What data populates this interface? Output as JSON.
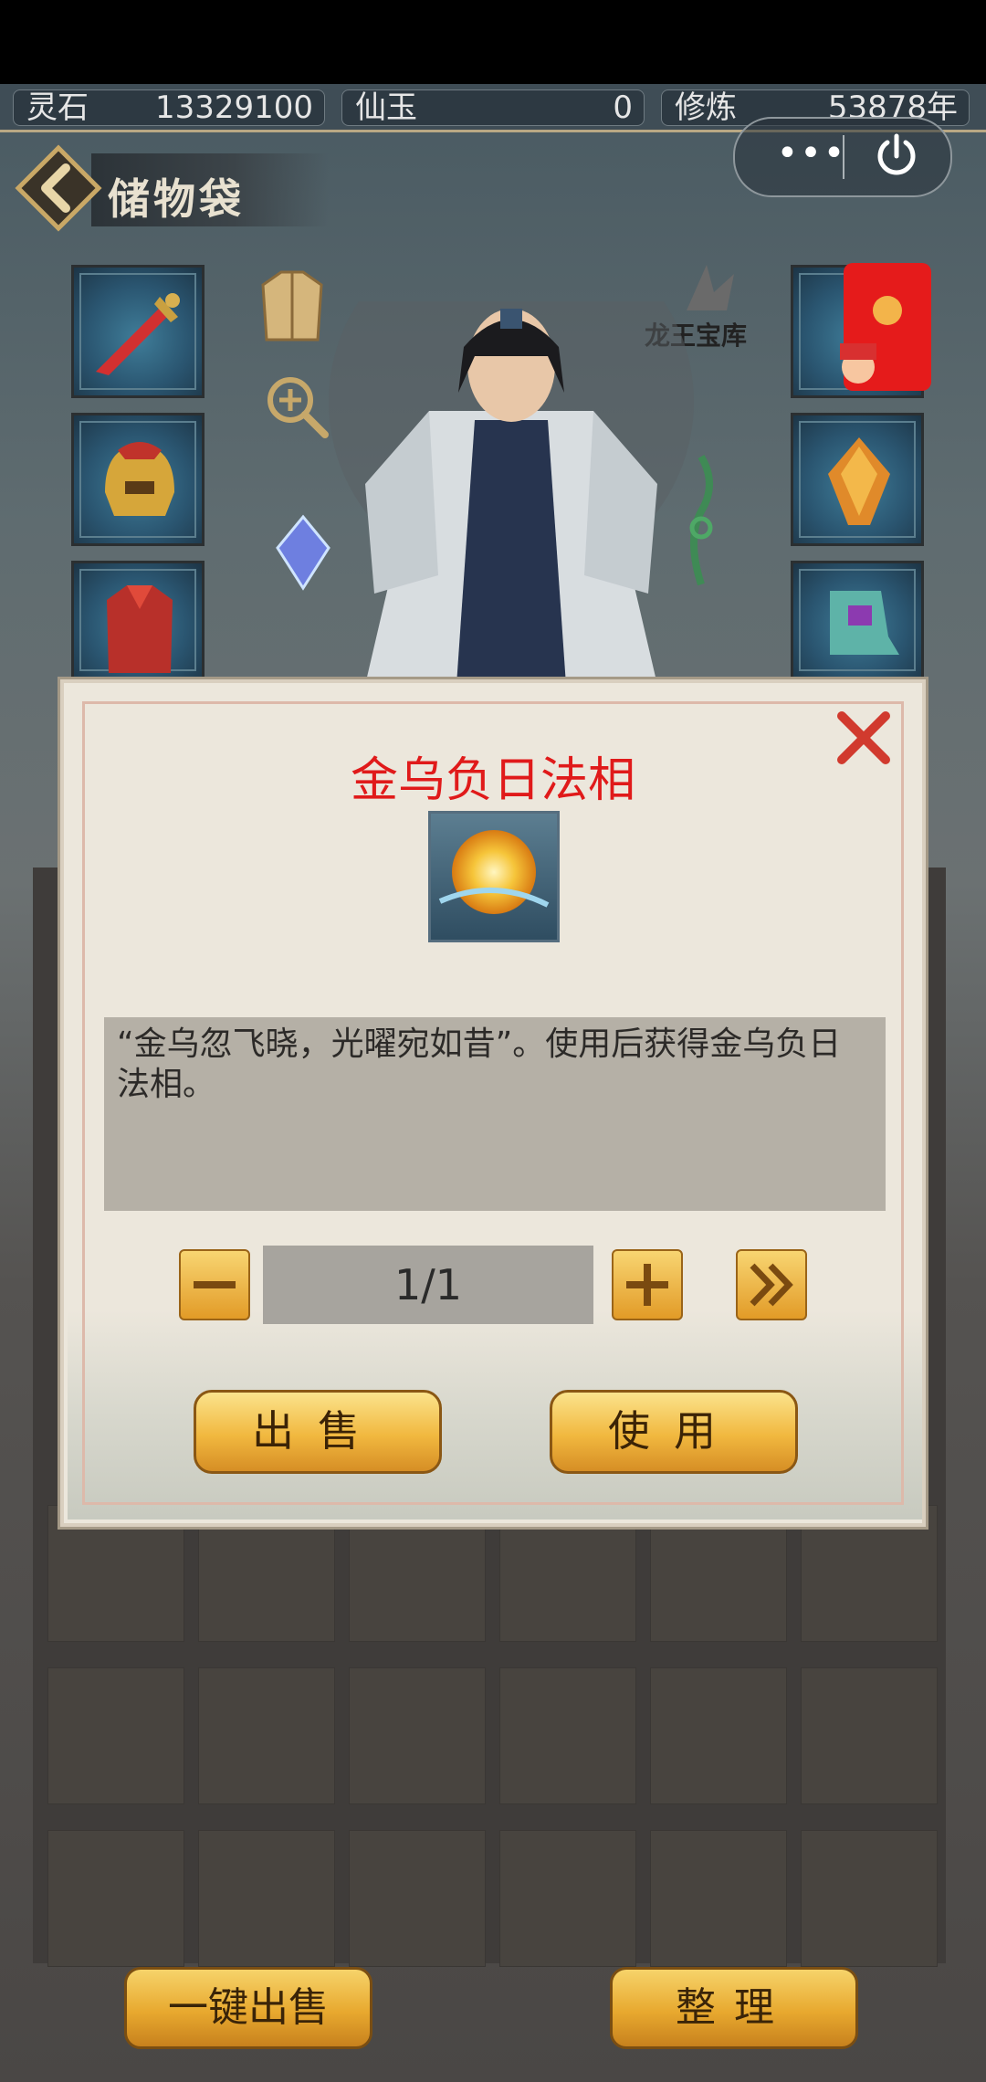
{
  "currency": {
    "items": [
      {
        "label": "灵石",
        "value": "13329100"
      },
      {
        "label": "仙玉",
        "value": "0"
      },
      {
        "label": "修炼",
        "value": "53878年"
      }
    ]
  },
  "capsule": {
    "more_label": "•••"
  },
  "header": {
    "title": "储物袋",
    "shop_label": "龙王宝库"
  },
  "dialog": {
    "item_name": "金乌负日法相",
    "description": "“金乌忽飞晓，光曜宛如昔”。使用后获得金乌负日法相。",
    "quantity": "1/1",
    "sell_label": "出售",
    "use_label": "使用"
  },
  "footer": {
    "quick_sell_label": "一键出售",
    "sort_label": "整理"
  },
  "colors": {
    "title_red": "#e01a1a",
    "gold": "#f1b83f",
    "panel": "#ece7dc"
  }
}
